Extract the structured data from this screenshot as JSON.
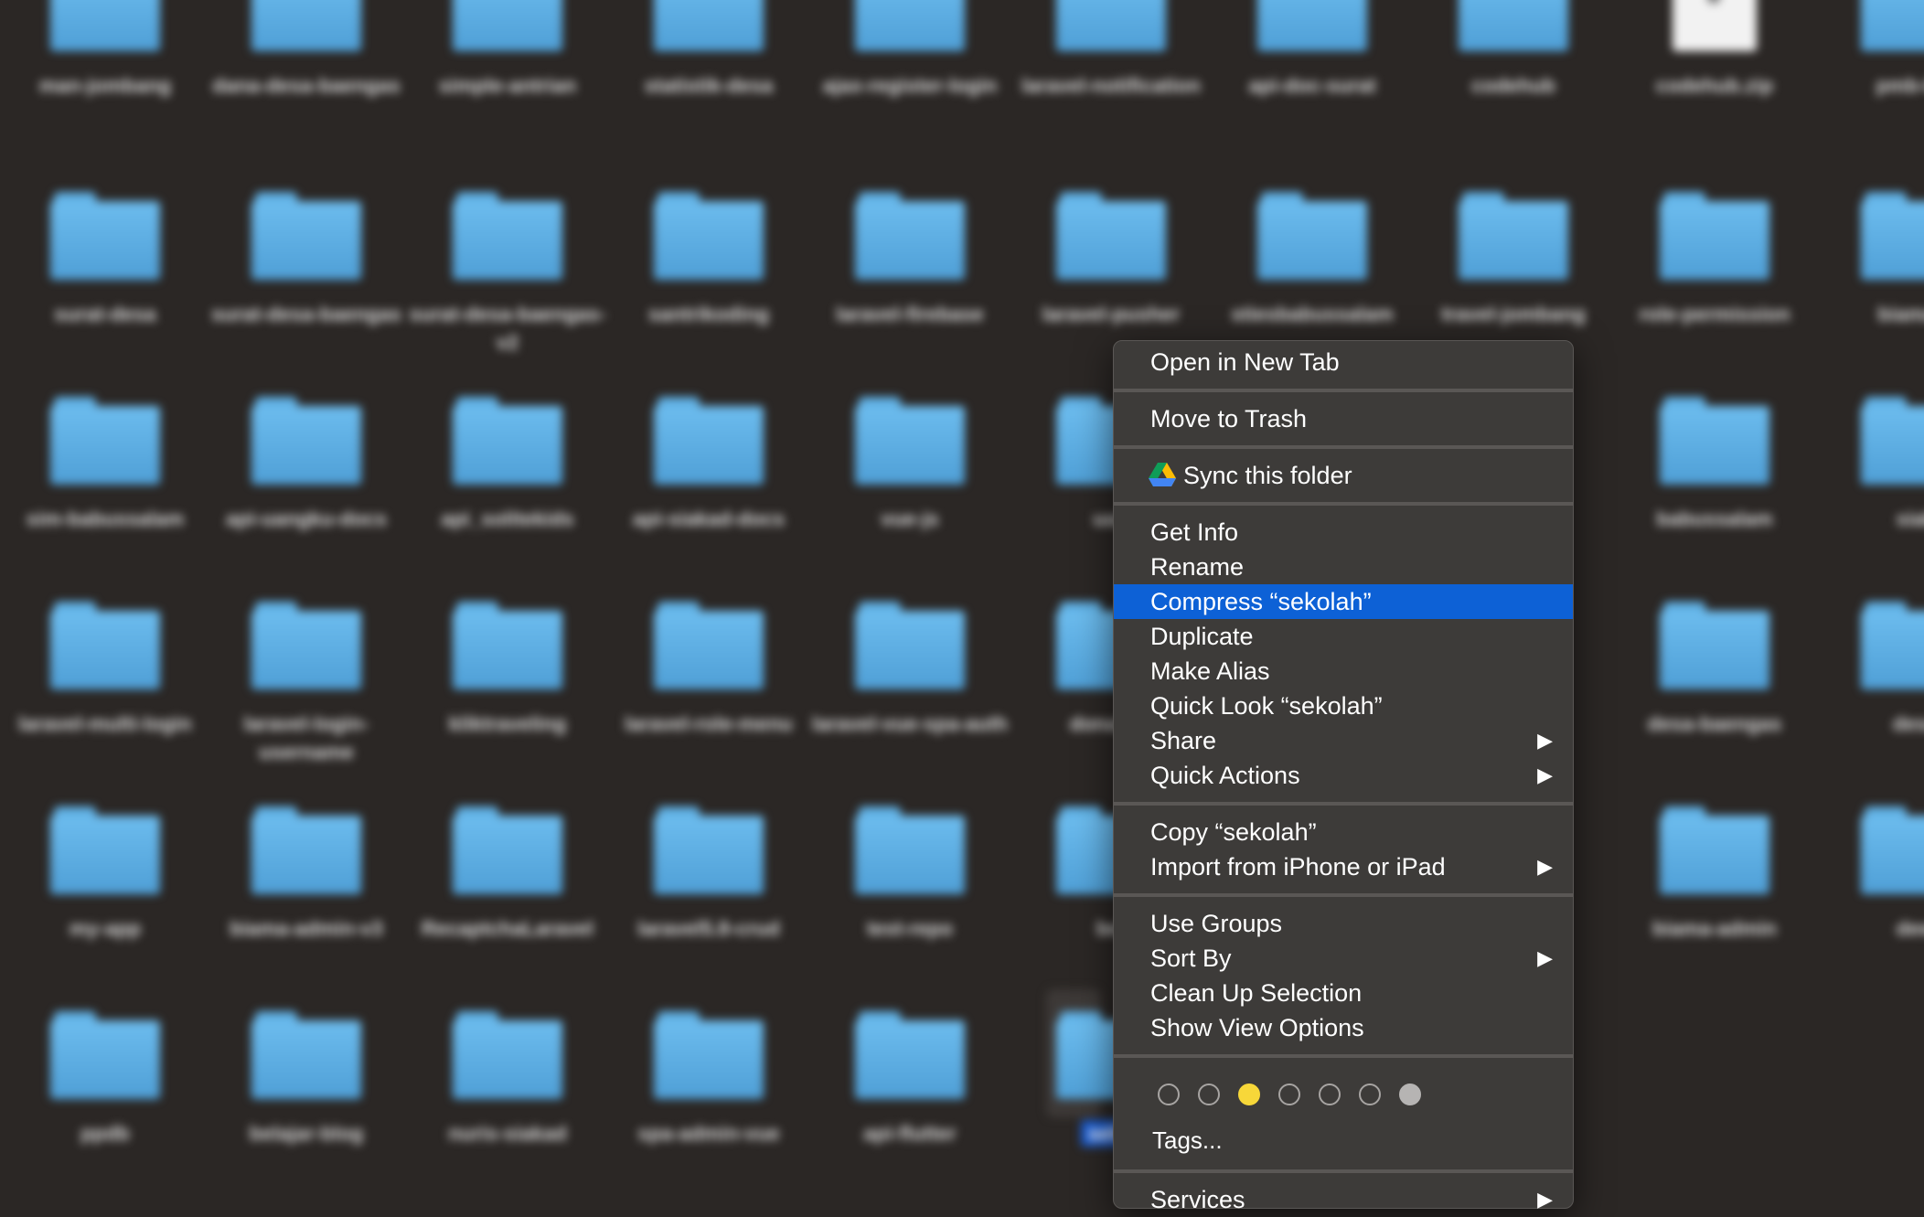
{
  "finder": {
    "items": [
      {
        "name": "man-jombang"
      },
      {
        "name": "dana-desa-baengas"
      },
      {
        "name": "simple-antrian"
      },
      {
        "name": "statistik-desa"
      },
      {
        "name": "ajax-register-login"
      },
      {
        "name": "laravel-notification"
      },
      {
        "name": "api-doc-surat"
      },
      {
        "name": "codehub"
      },
      {
        "name": "codehub.zip"
      },
      {
        "name": "pmb-bat"
      },
      {
        "name": "surat-desa"
      },
      {
        "name": "surat-desa-baengas"
      },
      {
        "name": "surat-desa-baengas-v2"
      },
      {
        "name": "santrikoding"
      },
      {
        "name": "laravel-firebase"
      },
      {
        "name": "laravel-pusher"
      },
      {
        "name": "stiesbabussalam"
      },
      {
        "name": "travel-jombang"
      },
      {
        "name": "role-permission"
      },
      {
        "name": "biama-a"
      },
      {
        "name": "sim-babussalam"
      },
      {
        "name": "api-uangku-docs"
      },
      {
        "name": "api_solitekids"
      },
      {
        "name": "api-siakad-docs"
      },
      {
        "name": "vue-js"
      },
      {
        "name": "uan"
      },
      {
        "name": "babussalam"
      },
      {
        "name": "siak"
      },
      {
        "name": "laravel-multi-login"
      },
      {
        "name": "laravel-login-username"
      },
      {
        "name": "kliktraveling"
      },
      {
        "name": "laravel-role-menu"
      },
      {
        "name": "laravel-vue-spa-auth"
      },
      {
        "name": "donasi-c"
      },
      {
        "name": "desa-baengas"
      },
      {
        "name": "desa"
      },
      {
        "name": "my-app"
      },
      {
        "name": "biama-admin-v3"
      },
      {
        "name": "RecaptchaLaravel"
      },
      {
        "name": "laravel5.8-crud"
      },
      {
        "name": "test-repo"
      },
      {
        "name": "bel"
      },
      {
        "name": "biama-admin"
      },
      {
        "name": "dew"
      },
      {
        "name": "ppdb"
      },
      {
        "name": "belajar-blog"
      },
      {
        "name": "nuris-siakad"
      },
      {
        "name": "spa-admin-vue"
      },
      {
        "name": "api-flutter"
      },
      {
        "name": "seko"
      }
    ]
  },
  "menu": {
    "open_new_tab": "Open in New Tab",
    "move_to_trash": "Move to Trash",
    "sync_folder": "Sync this folder",
    "get_info": "Get Info",
    "rename": "Rename",
    "compress": "Compress “sekolah”",
    "duplicate": "Duplicate",
    "make_alias": "Make Alias",
    "quick_look": "Quick Look “sekolah”",
    "share": "Share",
    "quick_actions": "Quick Actions",
    "copy": "Copy “sekolah”",
    "import_iphone": "Import from iPhone or iPad",
    "use_groups": "Use Groups",
    "sort_by": "Sort By",
    "clean_up": "Clean Up Selection",
    "view_options": "Show View Options",
    "tags": "Tags...",
    "services": "Services",
    "submenu_arrow": "▶",
    "highlight_color": "#0d61d6",
    "tag_colors": [
      "none",
      "none",
      "#f7d739",
      "none",
      "none",
      "none",
      "#b6b4b3"
    ]
  }
}
